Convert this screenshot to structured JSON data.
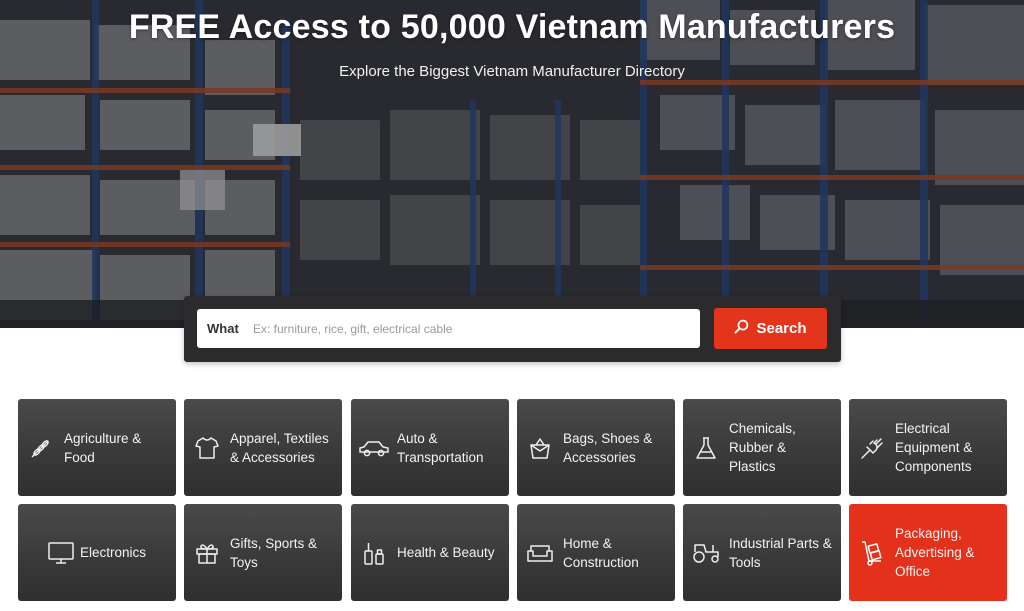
{
  "hero": {
    "title": "FREE Access to 50,000 Vietnam Manufacturers",
    "subtitle": "Explore the Biggest Vietnam Manufacturer Directory"
  },
  "search": {
    "label": "What",
    "placeholder": "Ex: furniture, rice, gift, electrical cable",
    "value": "",
    "button_label": "Search"
  },
  "colors": {
    "accent": "#e3351c",
    "tile_bg": "#3a3a3a",
    "search_bar_bg": "#2b2b2d"
  },
  "categories": [
    {
      "label": "Agriculture & Food",
      "icon": "wheat-icon"
    },
    {
      "label": "Apparel, Textiles & Accessories",
      "icon": "tshirt-icon"
    },
    {
      "label": "Auto & Transportation",
      "icon": "car-icon"
    },
    {
      "label": "Bags, Shoes & Accessories",
      "icon": "bag-icon"
    },
    {
      "label": "Chemicals, Rubber & Plastics",
      "icon": "flask-icon"
    },
    {
      "label": "Electrical Equipment & Components",
      "icon": "plug-icon"
    },
    {
      "label": "Electronics",
      "icon": "monitor-icon"
    },
    {
      "label": "Gifts, Sports & Toys",
      "icon": "gift-icon"
    },
    {
      "label": "Health & Beauty",
      "icon": "cosmetics-icon"
    },
    {
      "label": "Home & Construction",
      "icon": "sofa-icon"
    },
    {
      "label": "Industrial Parts & Tools",
      "icon": "tractor-icon"
    },
    {
      "label": "Packaging, Advertising & Office",
      "icon": "hand-truck-icon",
      "active": true
    }
  ]
}
